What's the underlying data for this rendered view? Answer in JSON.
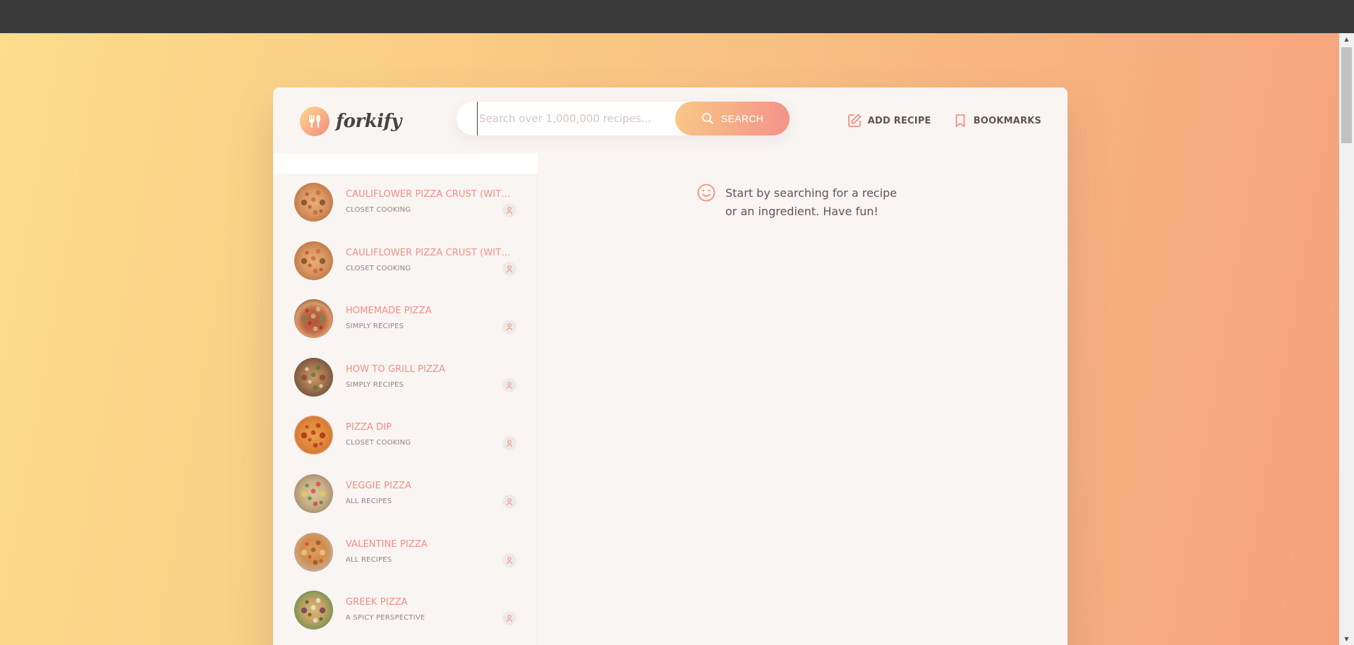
{
  "app": {
    "logo_text": "forkify"
  },
  "search": {
    "placeholder": "Search over 1,000,000 recipes...",
    "button_label": "SEARCH"
  },
  "nav": {
    "add_recipe": "ADD RECIPE",
    "bookmarks": "BOOKMARKS"
  },
  "message": {
    "text": "Start by searching for a recipe or an ingredient. Have fun!"
  },
  "results": [
    {
      "title": "CAULIFLOWER PIZZA CRUST (WITH BBQ CHICKEN PIZZA)",
      "publisher": "CLOSET COOKING",
      "thumb": "pizza-crust"
    },
    {
      "title": "CAULIFLOWER PIZZA CRUST (WITH BBQ CHICKEN PIZZA)",
      "publisher": "CLOSET COOKING",
      "thumb": "pizza-crust"
    },
    {
      "title": "HOMEMADE PIZZA",
      "publisher": "SIMPLY RECIPES",
      "thumb": "homemade-pizza"
    },
    {
      "title": "HOW TO GRILL PIZZA",
      "publisher": "SIMPLY RECIPES",
      "thumb": "grill-pizza"
    },
    {
      "title": "PIZZA DIP",
      "publisher": "CLOSET COOKING",
      "thumb": "pizza-dip"
    },
    {
      "title": "VEGGIE PIZZA",
      "publisher": "ALL RECIPES",
      "thumb": "veggie-pizza"
    },
    {
      "title": "VALENTINE PIZZA",
      "publisher": "ALL RECIPES",
      "thumb": "valentine-pizza"
    },
    {
      "title": "GREEK PIZZA",
      "publisher": "A SPICY PERSPECTIVE",
      "thumb": "greek-pizza"
    }
  ],
  "colors": {
    "accent": "#f38e82",
    "gradient_start": "#fbdb89",
    "gradient_end": "#f48982",
    "text": "#615551",
    "muted": "#918581"
  }
}
